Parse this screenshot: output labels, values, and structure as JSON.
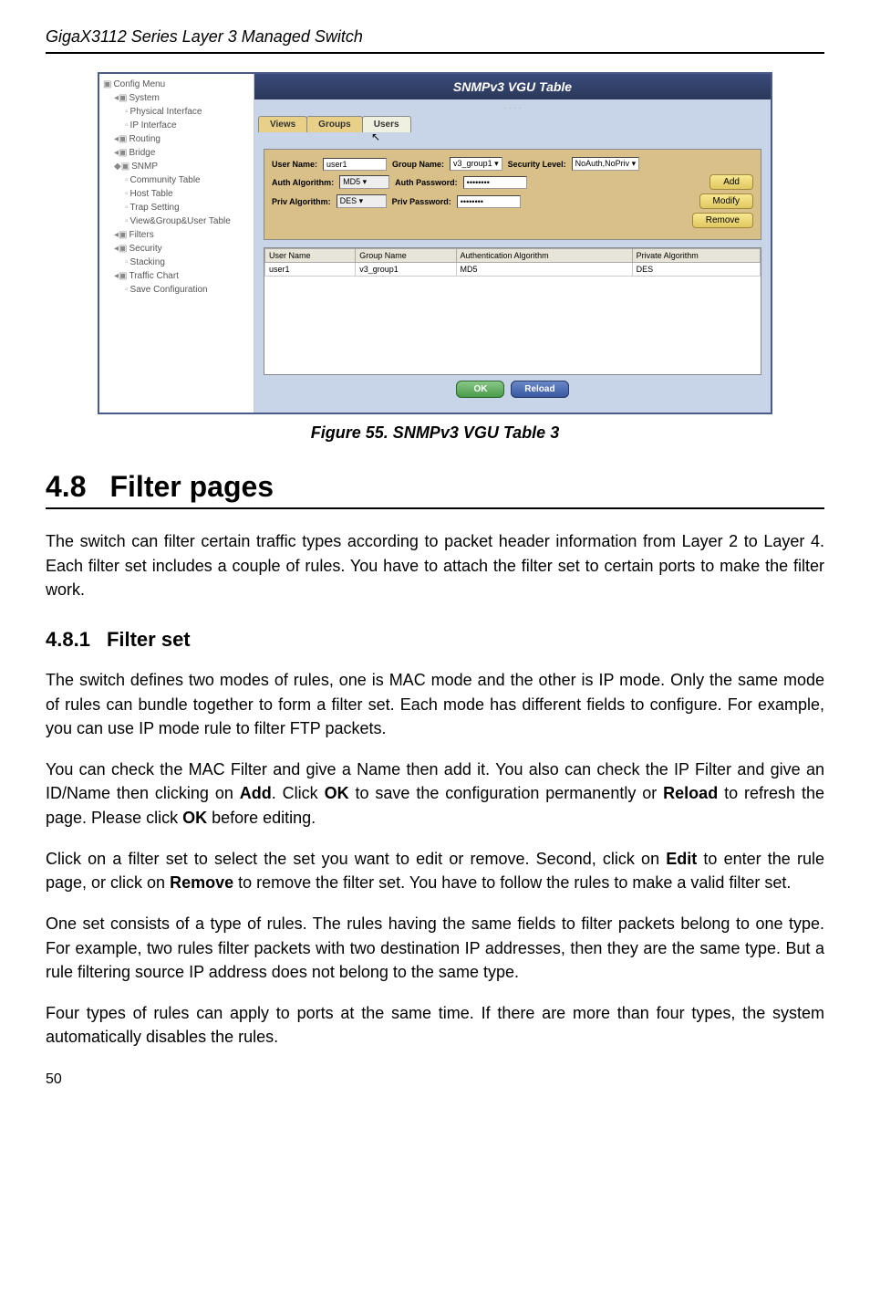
{
  "header": "GigaX3112 Series Layer 3 Managed Switch",
  "screenshot": {
    "tree_root": "Config Menu",
    "tree": {
      "system": "System",
      "physical_interface": "Physical Interface",
      "ip_interface": "IP Interface",
      "routing": "Routing",
      "bridge": "Bridge",
      "snmp": "SNMP",
      "community_table": "Community Table",
      "host_table": "Host Table",
      "trap_setting": "Trap Setting",
      "vgu_table": "View&Group&User Table",
      "filters": "Filters",
      "security": "Security",
      "stacking": "Stacking",
      "traffic_chart": "Traffic Chart",
      "save_config": "Save Configuration"
    },
    "title": "SNMPv3 VGU Table",
    "crumb": "·   ·   ·   ·",
    "tabs": {
      "views": "Views",
      "groups": "Groups",
      "users": "Users"
    },
    "form": {
      "user_name_lbl": "User Name:",
      "user_name_val": "user1",
      "group_name_lbl": "Group Name:",
      "group_name_val": "v3_group1 ▾",
      "security_level_lbl": "Security Level:",
      "security_level_val": "NoAuth,NoPriv ▾",
      "auth_alg_lbl": "Auth Algorithm:",
      "auth_alg_val": "MD5 ▾",
      "auth_pwd_lbl": "Auth Password:",
      "auth_pwd_val": "••••••••",
      "priv_alg_lbl": "Priv Algorithm:",
      "priv_alg_val": "DES ▾",
      "priv_pwd_lbl": "Priv Password:",
      "priv_pwd_val": "••••••••",
      "add_btn": "Add",
      "modify_btn": "Modify",
      "remove_btn": "Remove"
    },
    "table": {
      "h1": "User Name",
      "h2": "Group Name",
      "h3": "Authentication Algorithm",
      "h4": "Private Algorithm",
      "r1c1": "user1",
      "r1c2": "v3_group1",
      "r1c3": "MD5",
      "r1c4": "DES"
    },
    "ok_btn": "OK",
    "reload_btn": "Reload"
  },
  "figure_caption": "Figure 55. SNMPv3 VGU Table 3",
  "sections": {
    "h1_num": "4.8",
    "h1_title": "Filter pages",
    "p1": "The switch can filter certain traffic types according to packet header information from Layer 2 to Layer 4. Each filter set includes a couple of rules. You have to attach the filter set to certain ports to make the filter work.",
    "h2_num": "4.8.1",
    "h2_title": "Filter set",
    "p2": "The switch defines two modes of rules, one is MAC mode and the other is IP mode. Only the same mode of rules can bundle together to form a filter set. Each mode has different fields to configure. For example, you can use IP mode rule to filter FTP packets.",
    "p3a": "You can check the MAC Filter and give a Name then add it. You also can check the IP Filter and give an ID/Name then clicking on ",
    "p3b_add": "Add",
    "p3c": ". Click ",
    "p3d_ok": "OK",
    "p3e": " to save the configuration permanently or ",
    "p3f_reload": "Reload",
    "p3g": " to refresh the page. Please click ",
    "p3h_ok2": "OK",
    "p3i": " before editing.",
    "p4a": "Click on a filter set to select the set you want to edit or remove. Second, click on   ",
    "p4b_edit": "Edit",
    "p4c": " to enter the rule page, or click on ",
    "p4d_remove": "Remove",
    "p4e": " to remove the filter set. You have to follow the rules to make a valid filter set.",
    "p5": "One set consists of a type of rules. The rules having the same fields to filter packets belong to one type. For example, two rules filter packets with two destination IP addresses, then they are the same type. But a rule filtering source IP address does not belong to the same type.",
    "p6": "Four types of rules can apply to ports at the same time. If there are more than four types, the system automatically disables the rules."
  },
  "page_number": "50"
}
